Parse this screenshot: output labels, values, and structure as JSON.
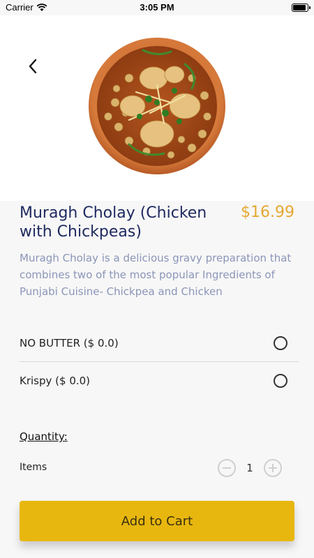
{
  "status_bar": {
    "carrier": "Carrier",
    "time": "3:05 PM"
  },
  "product": {
    "title": "Muragh Cholay (Chicken with Chickpeas)",
    "price": "$16.99",
    "description": "Muragh Cholay is a delicious gravy preparation that combines two of the most popular Ingredients of Punjabi Cuisine- Chickpea and Chicken"
  },
  "options": [
    {
      "label": "NO BUTTER ($ 0.0)",
      "selected": false
    },
    {
      "label": "Krispy ($ 0.0)",
      "selected": false
    }
  ],
  "quantity": {
    "heading": "Quantity:",
    "items_label": "Items",
    "value": "1"
  },
  "cart": {
    "label": "Add to Cart"
  },
  "colors": {
    "title": "#1f2a60",
    "price": "#e5a833",
    "description": "#8b95b8",
    "accent": "#e8b70f"
  },
  "icons": {
    "back": "chevron-left-icon",
    "minus": "minus-circle-icon",
    "plus": "plus-circle-icon"
  }
}
